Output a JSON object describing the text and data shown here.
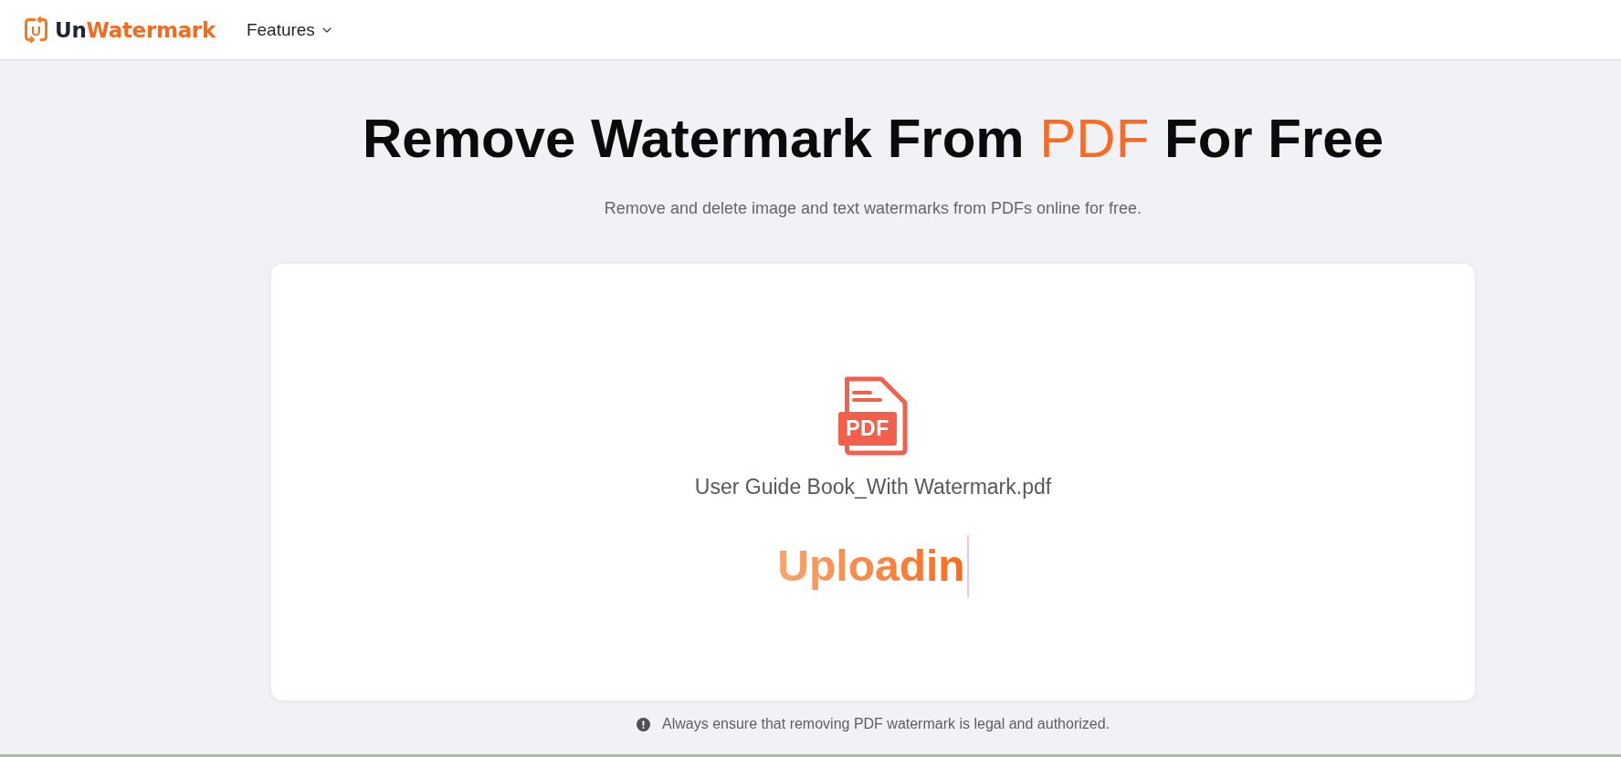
{
  "header": {
    "logo": {
      "mark": "U",
      "name_dark": "Un",
      "name_accent": "Watermark"
    },
    "nav": [
      {
        "label": "Features",
        "kind": "dropdown"
      }
    ]
  },
  "hero": {
    "title": {
      "before": "Remove Watermark From",
      "accent": "PDF",
      "after": "For Free"
    },
    "subtitle": "Remove and delete image and text watermarks from PDFs online for free."
  },
  "upload_card": {
    "file": {
      "icon_label": "PDF",
      "name": "User Guide Book_With Watermark.pdf"
    },
    "status": "Uploadin"
  },
  "notice": "Always ensure that removing PDF watermark is legal and authorized."
}
